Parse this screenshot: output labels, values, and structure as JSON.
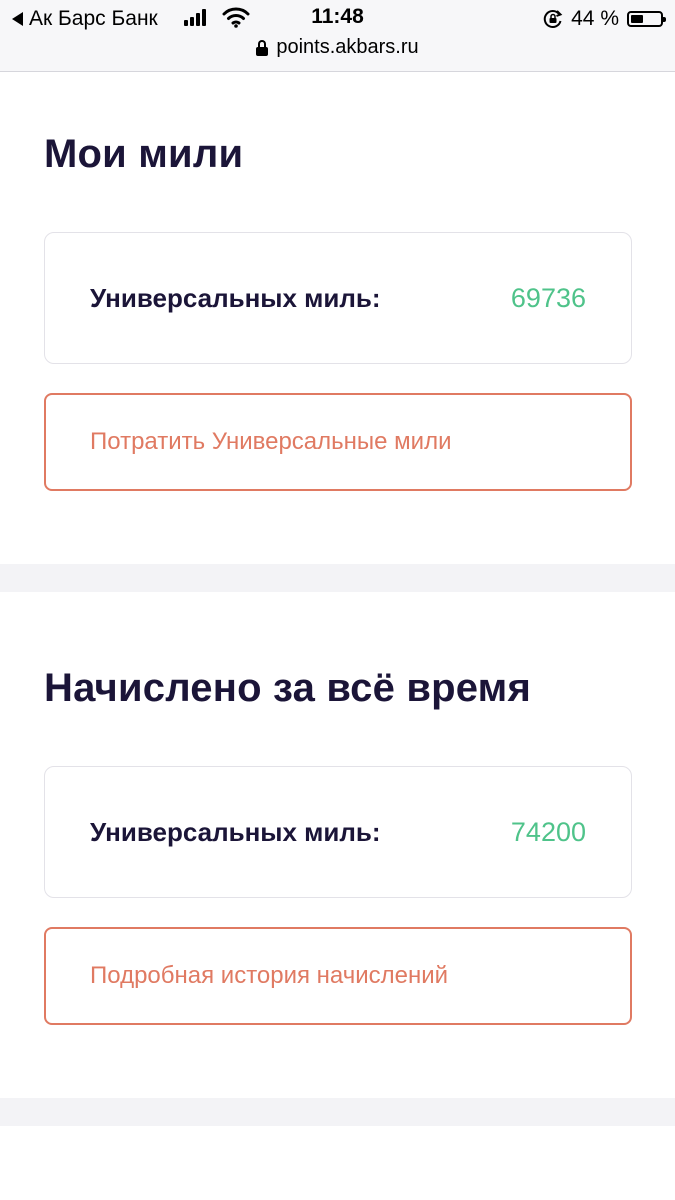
{
  "status_bar": {
    "back_app": "Ак Барс Банк",
    "time": "11:48",
    "battery_percent": "44 %",
    "battery_level": 0.44,
    "url": "points.akbars.ru"
  },
  "sections": [
    {
      "title": "Мои мили",
      "card": {
        "label": "Универсальных миль:",
        "value": "69736"
      },
      "button_label": "Потратить Универсальные мили"
    },
    {
      "title": "Начислено за всё время",
      "card": {
        "label": "Универсальных миль:",
        "value": "74200"
      },
      "button_label": "Подробная история начислений"
    }
  ],
  "colors": {
    "heading": "#1b1538",
    "value_green": "#4fc38a",
    "button_accent": "#e07a62",
    "divider": "#f3f3f6"
  }
}
